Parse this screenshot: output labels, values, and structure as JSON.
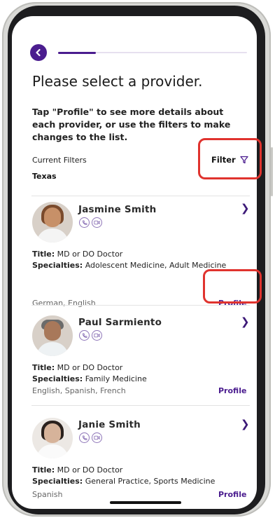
{
  "header": {
    "progress_percent": 20
  },
  "title": "Please select a provider.",
  "instructions": "Tap \"Profile\" to see more details about each provider, or use the filters to make changes to the list.",
  "filters": {
    "label": "Current Filters",
    "button_label": "Filter",
    "value": "Texas"
  },
  "providers": [
    {
      "name": "Jasmine Smith",
      "title_label": "Title:",
      "title": "MD or DO Doctor",
      "specialties_label": "Specialties:",
      "specialties": "Adolescent Medicine, Adult Medicine",
      "languages": "German, English",
      "profile_label": "Profile"
    },
    {
      "name": "Paul Sarmiento",
      "title_label": "Title:",
      "title": "MD or DO Doctor",
      "specialties_label": "Specialties:",
      "specialties": "Family Medicine",
      "languages": "English, Spanish, French",
      "profile_label": "Profile"
    },
    {
      "name": "Janie Smith",
      "title_label": "Title:",
      "title": "MD or DO Doctor",
      "specialties_label": "Specialties:",
      "specialties": "General Practice, Sports Medicine",
      "languages": "Spanish",
      "profile_label": "Profile"
    }
  ],
  "colors": {
    "accent": "#4b1d8f",
    "highlight": "#e0332e"
  }
}
